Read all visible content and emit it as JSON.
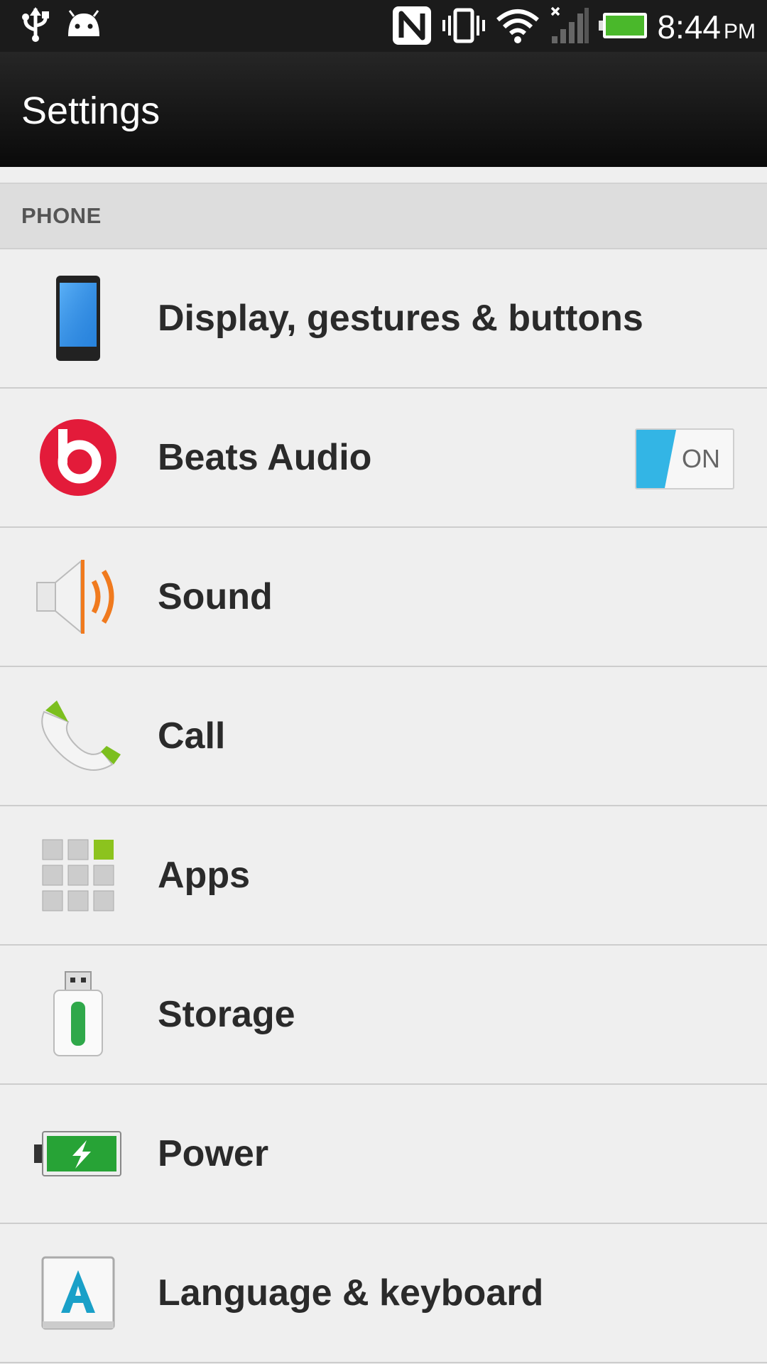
{
  "status_bar": {
    "time": "8:44",
    "ampm": "PM",
    "icons": [
      "usb-icon",
      "android-icon",
      "nfc-icon",
      "vibrate-icon",
      "wifi-icon",
      "signal-icon",
      "battery-icon"
    ]
  },
  "action_bar": {
    "title": "Settings"
  },
  "section": {
    "label": "PHONE"
  },
  "items": [
    {
      "label": "Display, gestures & buttons",
      "icon": "display-icon"
    },
    {
      "label": "Beats Audio",
      "icon": "beats-icon",
      "toggle": "ON"
    },
    {
      "label": "Sound",
      "icon": "speaker-icon"
    },
    {
      "label": "Call",
      "icon": "phone-icon"
    },
    {
      "label": "Apps",
      "icon": "apps-grid-icon"
    },
    {
      "label": "Storage",
      "icon": "usb-storage-icon"
    },
    {
      "label": "Power",
      "icon": "battery-power-icon"
    },
    {
      "label": "Language & keyboard",
      "icon": "language-keyboard-icon"
    }
  ],
  "colors": {
    "accent_blue": "#33b5e5",
    "beats_red": "#e31b3a",
    "battery_green": "#3cb521",
    "sound_orange": "#f07a1e"
  }
}
